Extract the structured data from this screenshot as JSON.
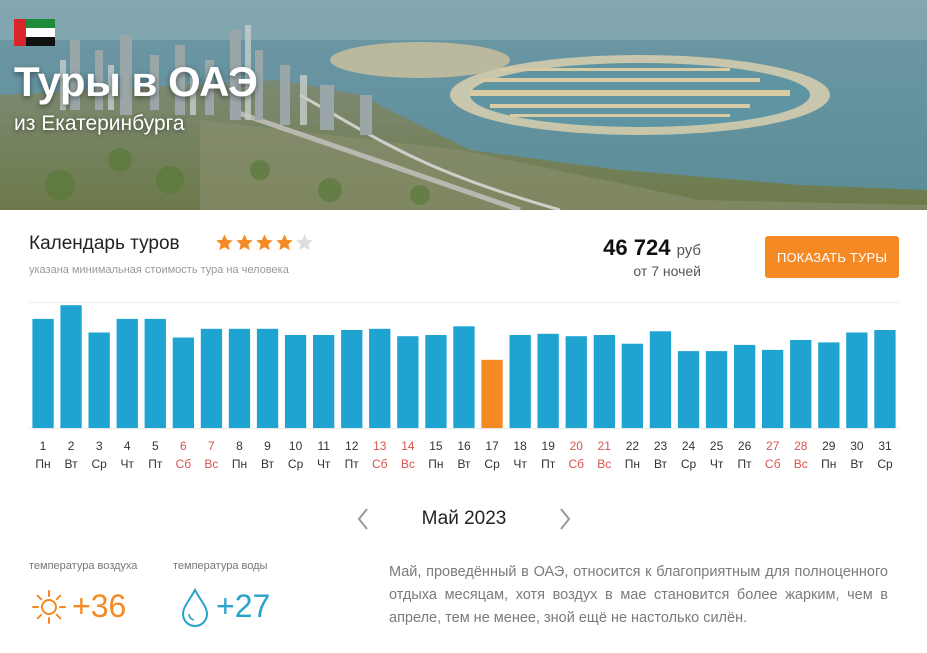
{
  "hero": {
    "title": "Туры в ОАЭ",
    "subtitle": "из Екатеринбурга",
    "flag_icon": "uae-flag-icon"
  },
  "calendar": {
    "title": "Календарь туров",
    "rating": 4,
    "rating_max": 5,
    "note": "указана минимальная стоимость тура на человека",
    "price_amount": "46 724",
    "price_currency": "руб",
    "nights": "от 7 ночей",
    "show_button": "ПОКАЗАТЬ ТУРЫ"
  },
  "colors": {
    "bar": "#1fa3d1",
    "bar_selected": "#f58a24",
    "weekend_text": "#d9534f",
    "accent": "#f58a24",
    "water": "#27a4cc"
  },
  "chart_data": {
    "type": "bar",
    "selected_day": 17,
    "categories": [
      "1",
      "2",
      "3",
      "4",
      "5",
      "6",
      "7",
      "8",
      "9",
      "10",
      "11",
      "12",
      "13",
      "14",
      "15",
      "16",
      "17",
      "18",
      "19",
      "20",
      "21",
      "22",
      "23",
      "24",
      "25",
      "26",
      "27",
      "28",
      "29",
      "30",
      "31"
    ],
    "weekdays": [
      "Пн",
      "Вт",
      "Ср",
      "Чт",
      "Пт",
      "Сб",
      "Вс",
      "Пн",
      "Вт",
      "Ср",
      "Чт",
      "Пт",
      "Сб",
      "Вс",
      "Пн",
      "Вт",
      "Ср",
      "Чт",
      "Пт",
      "Сб",
      "Вс",
      "Пн",
      "Вт",
      "Ср",
      "Чт",
      "Пт",
      "Сб",
      "Вс",
      "Пн",
      "Вт",
      "Ср"
    ],
    "weekend": [
      false,
      false,
      false,
      false,
      false,
      true,
      true,
      false,
      false,
      false,
      false,
      false,
      true,
      true,
      false,
      false,
      false,
      false,
      false,
      true,
      true,
      false,
      false,
      false,
      false,
      false,
      true,
      true,
      false,
      false,
      false
    ],
    "values": [
      0.88,
      0.99,
      0.77,
      0.88,
      0.88,
      0.73,
      0.8,
      0.8,
      0.8,
      0.75,
      0.75,
      0.79,
      0.8,
      0.74,
      0.75,
      0.82,
      0.55,
      0.75,
      0.76,
      0.74,
      0.75,
      0.68,
      0.78,
      0.62,
      0.62,
      0.67,
      0.63,
      0.71,
      0.69,
      0.77,
      0.79
    ],
    "ylim": [
      0,
      1
    ]
  },
  "month_nav": {
    "label": "Май 2023",
    "prev_icon": "chevron-left-icon",
    "next_icon": "chevron-right-icon"
  },
  "weather": {
    "air_label": "температура воздуха",
    "air_value": "+36",
    "air_icon": "sun-icon",
    "water_label": "температура воды",
    "water_value": "+27",
    "water_icon": "water-drop-icon"
  },
  "description": "Май, проведённый в ОАЭ, относится к благоприятным для полноценного отдыха месяцам, хотя воздух в мае становится более жарким, чем в апреле, тем не менее, зной ещё не настолько силён."
}
